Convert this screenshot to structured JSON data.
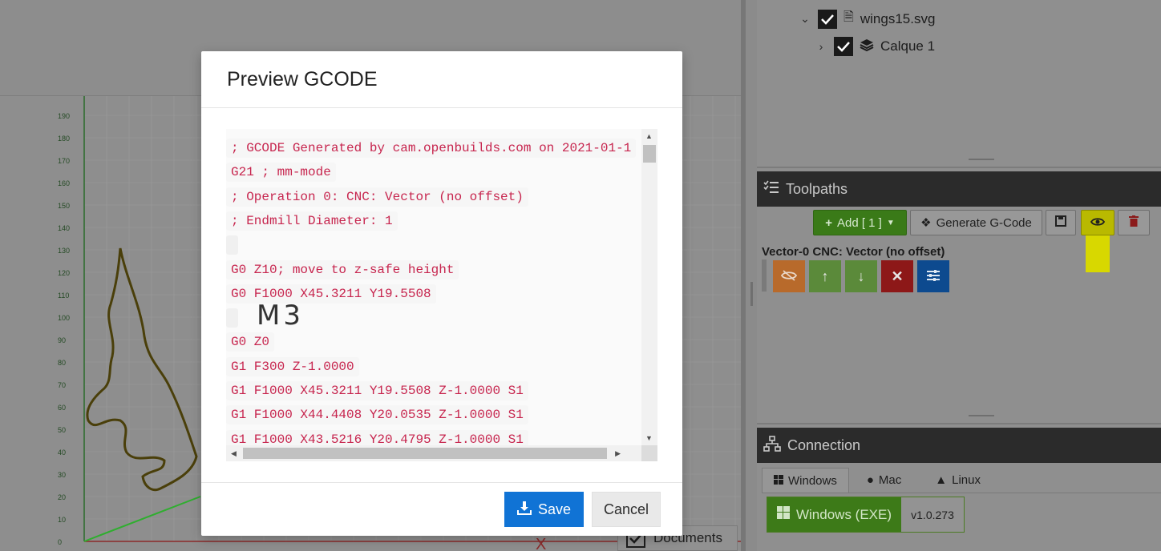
{
  "modal": {
    "title": "Preview GCODE",
    "lines": [
      "; GCODE Generated by cam.openbuilds.com on 2021-01-1",
      "G21 ; mm-mode",
      "; Operation 0: CNC: Vector (no offset)",
      "; Endmill Diameter: 1",
      "",
      "G0 Z10; move to z-safe height",
      "G0 F1000 X45.3211 Y19.5508",
      "",
      "G0 Z0",
      "G1 F300 Z-1.0000",
      "G1 F1000 X45.3211 Y19.5508 Z-1.0000 S1",
      "G1 F1000 X44.4408 Y20.0535 Z-1.0000 S1",
      "G1 F1000 X43.5216 Y20.4795 Z-1.0000 S1"
    ],
    "handwritten_note": "M3",
    "save_label": "Save",
    "cancel_label": "Cancel"
  },
  "tree": {
    "file_name": "wings15.svg",
    "layer_name": "Calque 1"
  },
  "toolpaths": {
    "title": "Toolpaths",
    "add_label": "Add [ 1 ]",
    "generate_label": "Generate G-Code",
    "item_label": "Vector-0 CNC: Vector (no offset)"
  },
  "connection": {
    "title": "Connection",
    "tabs": [
      "Windows",
      "Mac",
      "Linux"
    ],
    "download_label": "Windows (EXE)",
    "version": "v1.0.273"
  },
  "documents_label": "Documents",
  "chart_axis_ticks": [
    "0",
    "10",
    "20",
    "30",
    "40",
    "50",
    "60",
    "70",
    "80",
    "90",
    "100",
    "110",
    "120",
    "130",
    "140",
    "150",
    "160",
    "170",
    "180",
    "190"
  ],
  "colors": {
    "accent_blue": "#1073d5",
    "code_red": "#c7254e",
    "highlight_yellow": "#e6e600"
  }
}
